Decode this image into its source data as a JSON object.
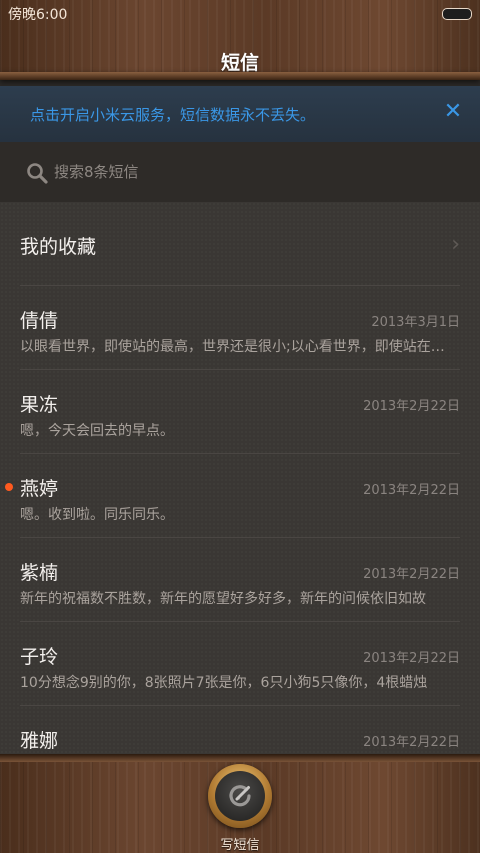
{
  "status_bar": {
    "time": "傍晚6:00"
  },
  "header": {
    "title": "短信"
  },
  "banner": {
    "text": "点击开启小米云服务，短信数据永不丢失。",
    "close_icon": "close-icon"
  },
  "search": {
    "placeholder": "搜索8条短信",
    "icon": "search-icon"
  },
  "favorites": {
    "label": "我的收藏",
    "icon": "chevron-right-icon"
  },
  "conversations": [
    {
      "name": "倩倩",
      "date": "2013年3月1日",
      "preview": "以眼看世界，即使站的最高，世界还是很小;以心看世界，即使站在最低处，世界也是很大",
      "unread": false
    },
    {
      "name": "果冻",
      "date": "2013年2月22日",
      "preview": "嗯，今天会回去的早点。",
      "unread": false
    },
    {
      "name": "燕婷",
      "date": "2013年2月22日",
      "preview": "嗯。收到啦。同乐同乐。",
      "unread": true
    },
    {
      "name": "紫楠",
      "date": "2013年2月22日",
      "preview": "新年的祝福数不胜数，新年的愿望好多好多，新年的问候依旧如故",
      "unread": false
    },
    {
      "name": "子玲",
      "date": "2013年2月22日",
      "preview": "10分想念9别的你，8张照片7张是你，6只小狗5只像你，4根蜡烛",
      "unread": false
    },
    {
      "name": "雅娜",
      "date": "2013年2月22日",
      "preview": "",
      "unread": false
    }
  ],
  "footer": {
    "compose_label": "写短信",
    "compose_icon": "compose-icon"
  },
  "colors": {
    "accent": "#3a97e6",
    "unread_dot": "#ff5a1f"
  }
}
